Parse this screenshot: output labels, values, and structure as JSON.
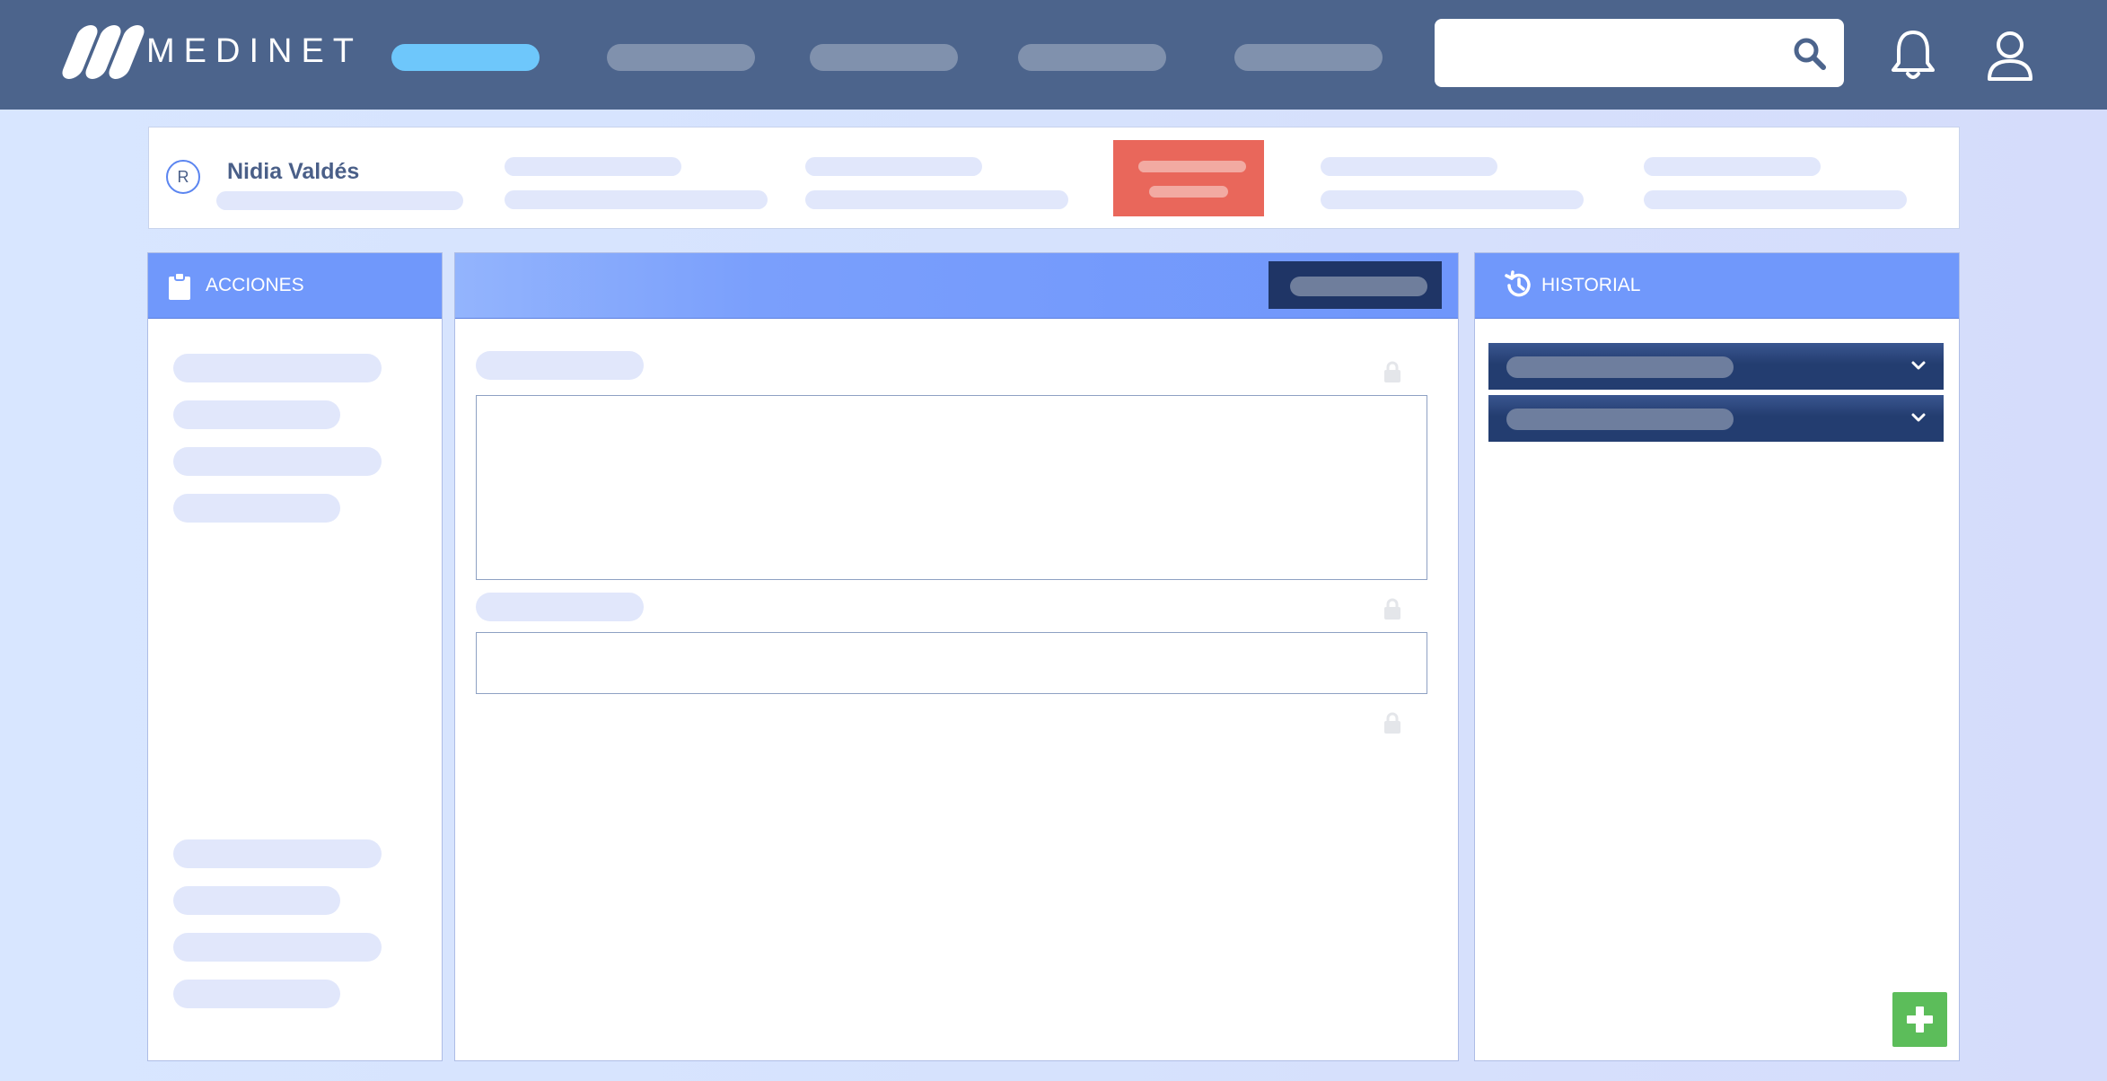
{
  "app": {
    "brand": "MEDINET"
  },
  "patient": {
    "name": "Nidia Valdés",
    "avatar_initial": "R"
  },
  "actions_panel": {
    "title": "ACCIONES"
  },
  "history_panel": {
    "title": "HISTORIAL"
  },
  "colors": {
    "topbar": "#4c648c",
    "active_nav": "#6ec7fb",
    "alert": "#e9675b",
    "panel_header": "#7098fb",
    "dark_button": "#1f3566",
    "add_button": "#5cbd5a"
  },
  "icons": {
    "search": "search-icon",
    "notifications": "bell-icon",
    "user": "user-icon",
    "actions": "clipboard-icon",
    "history": "history-icon",
    "lock": "lock-icon",
    "expand": "chevron-down-icon",
    "add": "plus-icon"
  }
}
